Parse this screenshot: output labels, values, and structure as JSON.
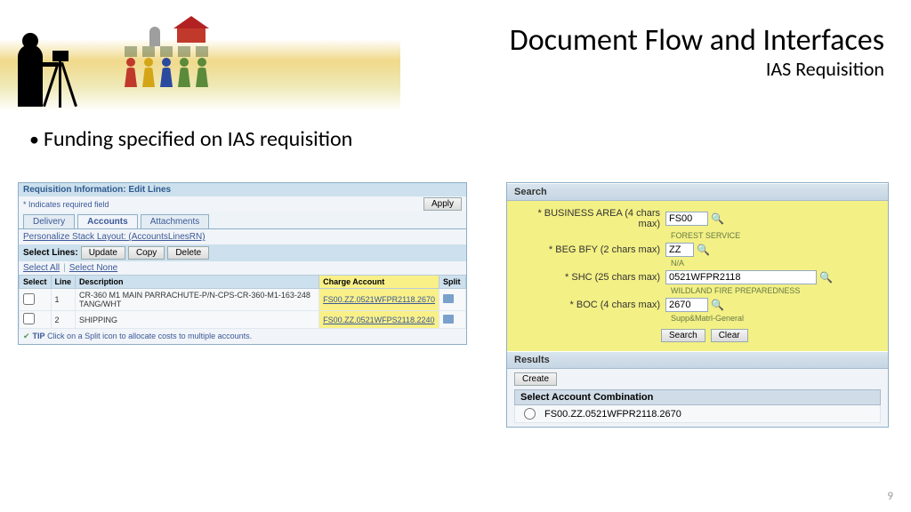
{
  "slide": {
    "title": "Document Flow and Interfaces",
    "subtitle": "IAS Requisition",
    "bullet": "Funding specified on IAS requisition",
    "page_number": "9"
  },
  "left": {
    "header": "Requisition Information: Edit Lines",
    "required_hint": "* Indicates required field",
    "apply_btn": "Apply",
    "tabs": {
      "delivery": "Delivery",
      "accounts": "Accounts",
      "attachments": "Attachments"
    },
    "personalize": "Personalize Stack Layout: (AccountsLinesRN)",
    "select_lines_label": "Select Lines:",
    "update_btn": "Update",
    "copy_btn": "Copy",
    "delete_btn": "Delete",
    "select_all": "Select All",
    "select_none": "Select None",
    "cols": {
      "select": "Select",
      "line": "Line",
      "desc": "Description",
      "charge": "Charge Account",
      "split": "Split"
    },
    "rows": [
      {
        "line": "1",
        "desc": "CR-360 M1 MAIN PARRACHUTE-P/N-CPS-CR-360-M1-163-248 TANG/WHT",
        "charge": "FS00.ZZ.0521WFPR2118.2670"
      },
      {
        "line": "2",
        "desc": "SHIPPING",
        "charge": "FS00.ZZ.0521WFPS2118.2240"
      }
    ],
    "tip_label": "TIP",
    "tip": " Click on a Split icon to allocate costs to multiple accounts."
  },
  "right": {
    "search_header": "Search",
    "fields": {
      "ba_label": "* BUSINESS AREA (4 chars max)",
      "ba_value": "FS00",
      "ba_desc": "FOREST SERVICE",
      "bfy_label": "* BEG BFY (2 chars max)",
      "bfy_value": "ZZ",
      "bfy_desc": "N/A",
      "shc_label": "* SHC (25 chars max)",
      "shc_value": "0521WFPR2118",
      "shc_desc": "WILDLAND FIRE PREPAREDNESS",
      "boc_label": "* BOC (4 chars max)",
      "boc_value": "2670",
      "boc_desc": "Supp&Matrl-General"
    },
    "search_btn": "Search",
    "clear_btn": "Clear",
    "results_header": "Results",
    "create_btn": "Create",
    "select_comb": "Select Account Combination",
    "combination": "FS00.ZZ.0521WFPR2118.2670"
  }
}
